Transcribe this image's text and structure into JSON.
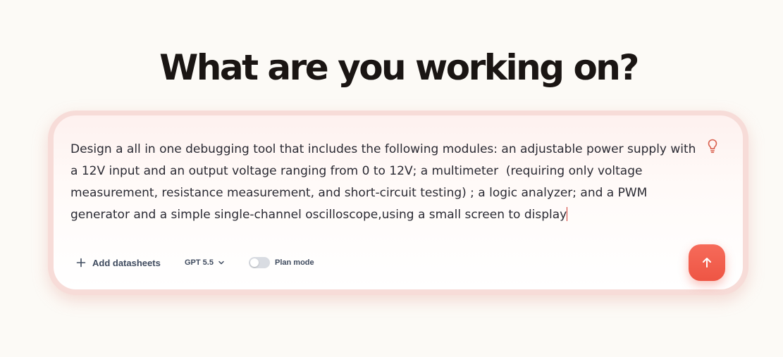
{
  "heading": "What are you working on?",
  "prompt": {
    "value": "Design a all in one debugging tool that includes the following modules: an adjustable power supply with a 12V input and an output voltage ranging from 0 to 12V; a multimeter  (requiring only voltage measurement, resistance measurement, and short-circuit testing) ; a logic analyzer; and a PWM generator and a simple single-channel oscilloscope,using a small screen to display"
  },
  "toolbar": {
    "add_datasheets_label": "Add datasheets",
    "model_label": "GPT 5.5",
    "plan_mode_label": "Plan mode",
    "plan_mode_enabled": false
  },
  "icons": {
    "hint": "lightbulb-icon",
    "add": "plus-icon",
    "model_dropdown": "chevron-down-icon",
    "send": "arrow-up-icon"
  },
  "colors": {
    "accent": "#ee5544",
    "heading": "#1a1513",
    "toolbar_text": "#3f4b5f",
    "background": "#fcfaf6"
  }
}
